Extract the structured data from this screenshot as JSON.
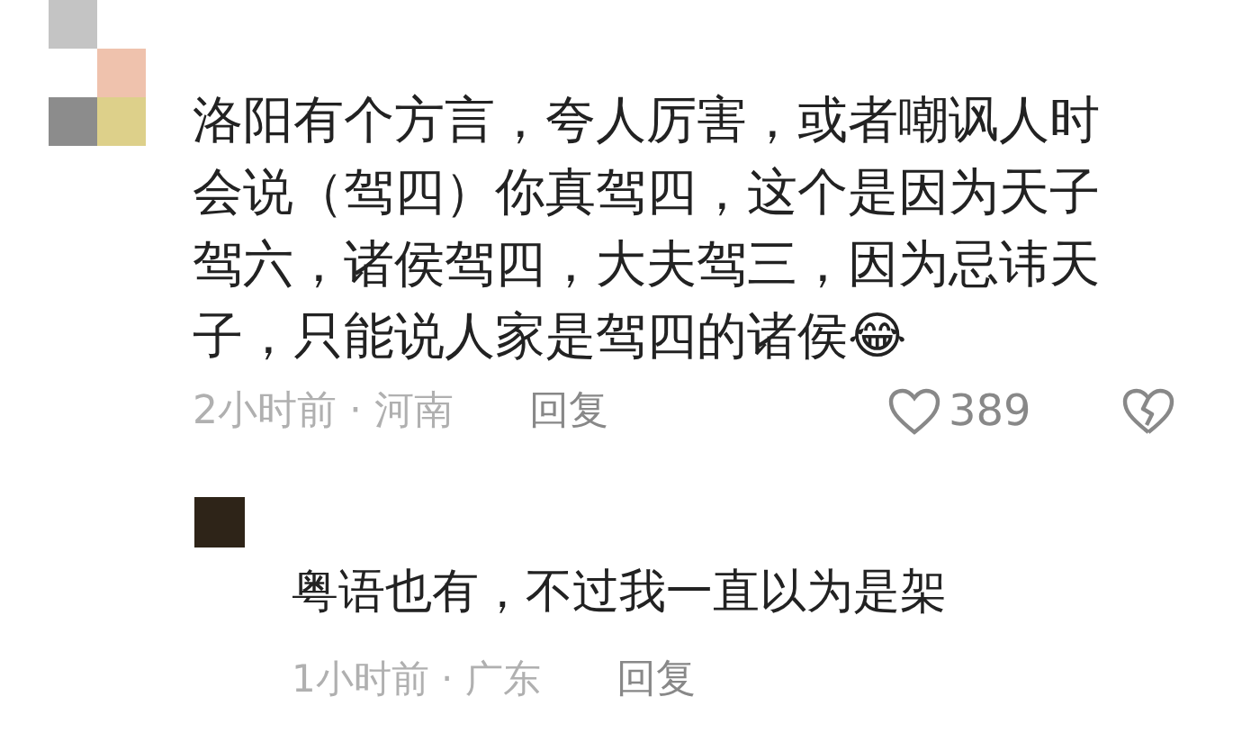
{
  "comments": [
    {
      "kind": "comment",
      "text": "洛阳有个方言，夸人厉害，或者嘲讽人时会说（驾四）你真驾四，这个是因为天子驾六，诸侯驾四，大夫驾三，因为忌讳天子，只能说人家是驾四的诸侯😂",
      "time": "2小时前 · 河南",
      "reply_label": "回复",
      "likes": "389"
    },
    {
      "kind": "reply",
      "text": "粤语也有，不过我一直以为是架",
      "time": "1小时前 · 广东",
      "reply_label": "回复"
    }
  ]
}
